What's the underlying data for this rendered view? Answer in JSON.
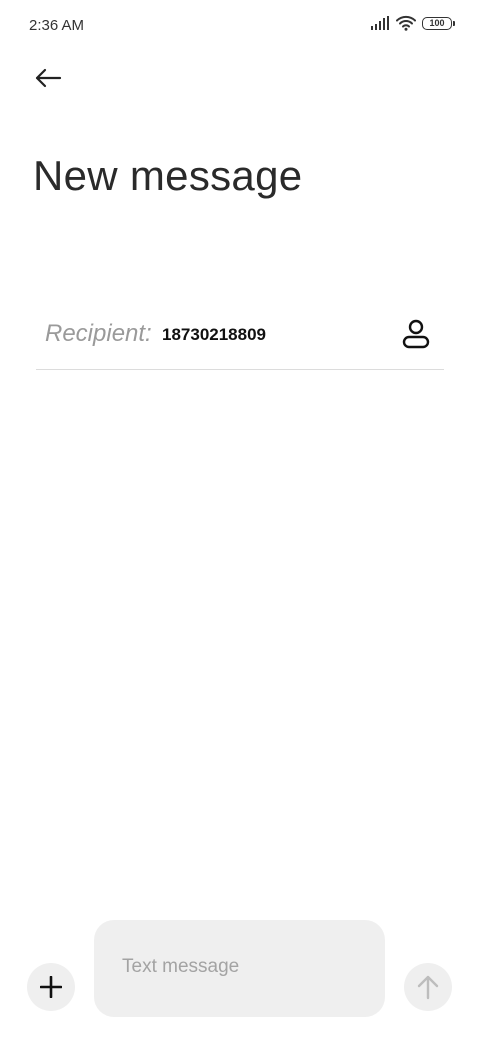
{
  "status_bar": {
    "time": "2:36 AM",
    "battery": "100",
    "icons": [
      "signal-icon",
      "wifi-icon",
      "battery-icon"
    ]
  },
  "header": {
    "back_icon": "arrow-left-icon",
    "title": "New message"
  },
  "recipient": {
    "label": "Recipient:",
    "value": "18730218809",
    "contact_icon": "person-icon"
  },
  "composer": {
    "attach_icon": "plus-icon",
    "placeholder": "Text message",
    "value": "",
    "send_icon": "arrow-up-icon"
  },
  "colors": {
    "background": "#ffffff",
    "input_background": "#efefef",
    "placeholder": "#a3a3a3",
    "send_disabled": "#bdbdbd"
  }
}
